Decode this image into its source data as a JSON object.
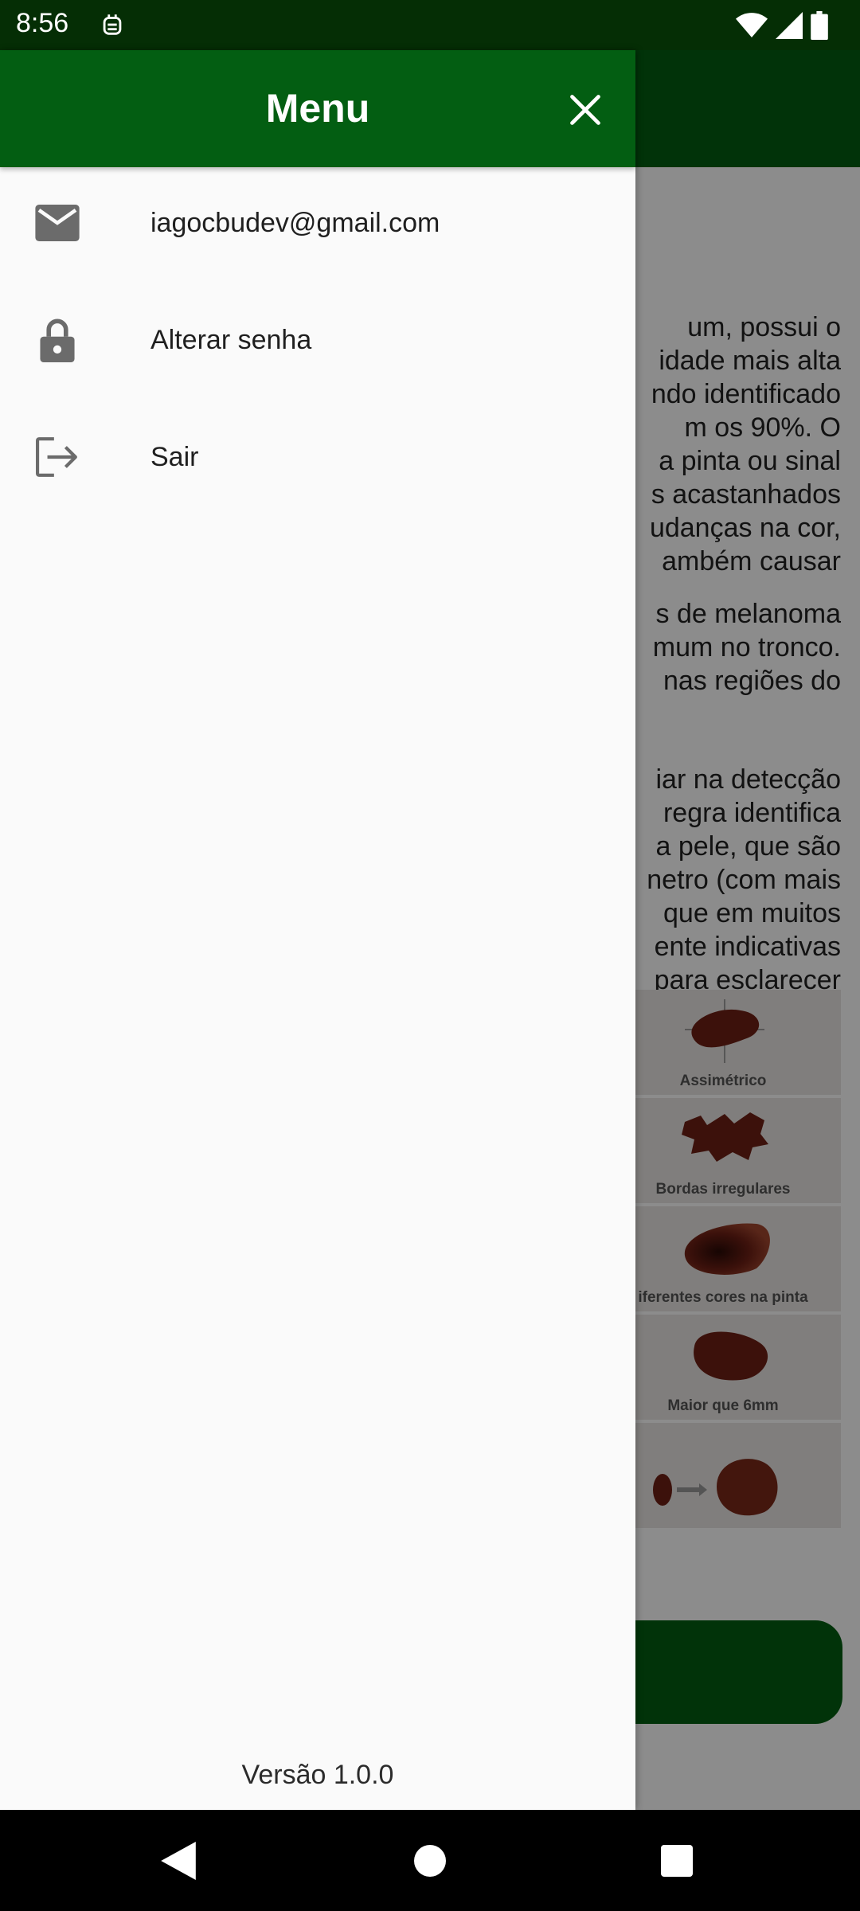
{
  "status_bar": {
    "time": "8:56",
    "icons": [
      "notification-icon",
      "wifi-icon",
      "cell-signal-icon",
      "battery-icon"
    ]
  },
  "drawer": {
    "title": "Menu",
    "items": [
      {
        "icon": "email-icon",
        "label": "iagocbudev@gmail.com"
      },
      {
        "icon": "lock-icon",
        "label": "Alterar senha"
      },
      {
        "icon": "logout-icon",
        "label": "Sair"
      }
    ],
    "version": "Versão 1.0.0"
  },
  "background": {
    "paragraph1": [
      "um,  possui  o",
      "idade mais alta",
      "ndo identificado",
      "m  os  90%.  O",
      "a pinta ou sinal",
      "s acastanhados",
      "udanças na cor,",
      "ambém  causar"
    ],
    "paragraph2": [
      "s de melanoma",
      "mum no tronco.",
      "nas regiões do"
    ],
    "paragraph3": [
      "iar na detecção",
      "regra identifica",
      "a pele, que são",
      "netro (com mais",
      "que em muitos",
      "ente indicativas",
      "para esclarecer"
    ],
    "figure_captions": [
      "Assimétrico",
      "Bordas irregulares",
      "iferentes cores na pinta",
      "Maior que 6mm",
      ""
    ]
  },
  "colors": {
    "primary": "#035e12",
    "status_bar": "#052e05",
    "drawer_bg": "#fafafa",
    "icon_gray": "#6b6b6b"
  }
}
